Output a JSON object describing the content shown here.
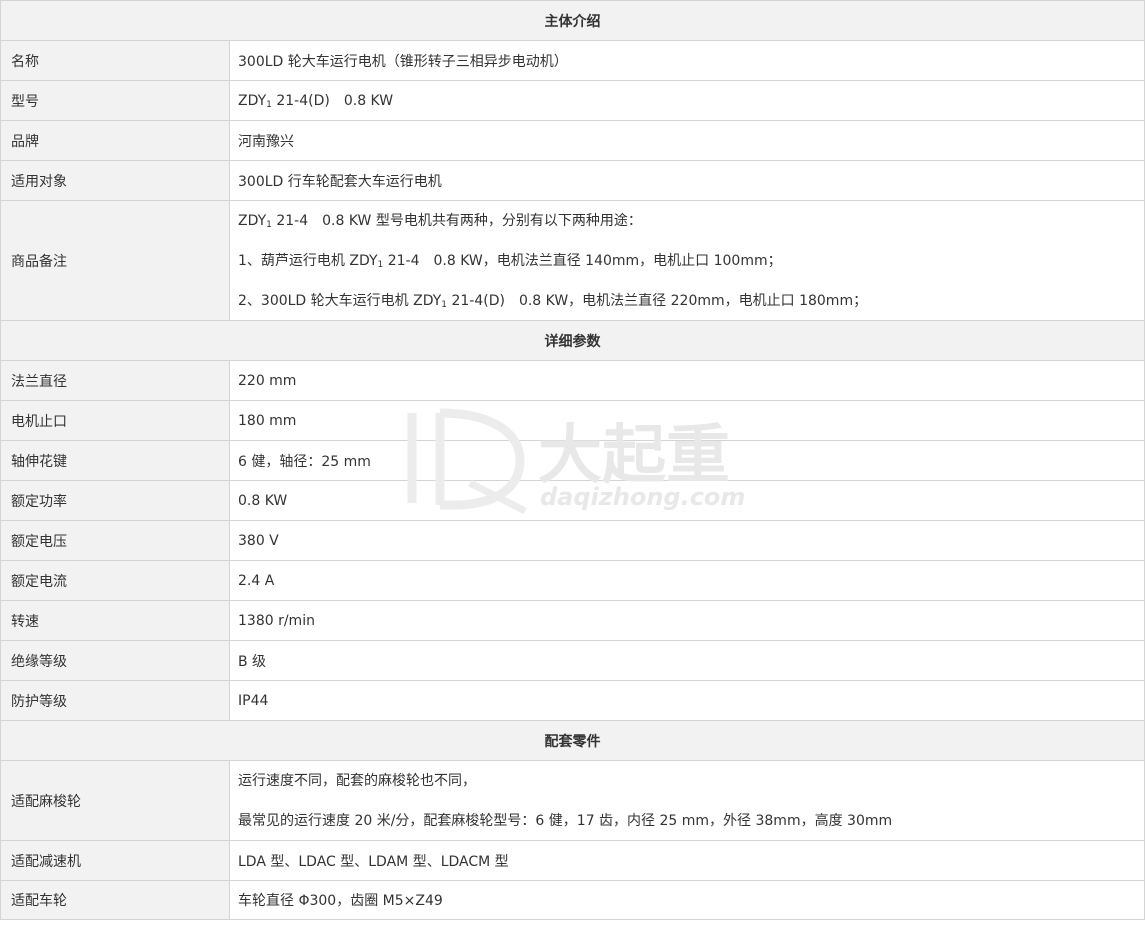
{
  "sections": {
    "intro": "主体介绍",
    "params": "详细参数",
    "parts": "配套零件"
  },
  "intro": {
    "name_label": "名称",
    "name_value": "300LD 轮大车运行电机（锥形转子三相异步电动机）",
    "model_label": "型号",
    "model_prefix": "ZDY",
    "model_sub": "1",
    "model_rest": " 21-4(D)　0.8 KW",
    "brand_label": "品牌",
    "brand_value": "河南豫兴",
    "target_label": "适用对象",
    "target_value": "300LD 行车轮配套大车运行电机",
    "note_label": "商品备注",
    "note_line1_prefix": "ZDY",
    "note_line1_sub": "1",
    "note_line1_rest": " 21-4　0.8 KW 型号电机共有两种，分别有以下两种用途：",
    "note_line2_prefix": "1、葫芦运行电机 ZDY",
    "note_line2_sub": "1",
    "note_line2_rest": " 21-4　0.8 KW，电机法兰直径 140mm，电机止口 100mm；",
    "note_line3_prefix": "2、300LD 轮大车运行电机 ZDY",
    "note_line3_sub": "1",
    "note_line3_rest": " 21-4(D)　0.8 KW，电机法兰直径 220mm，电机止口 180mm；"
  },
  "params": [
    {
      "label": "法兰直径",
      "value": "220 mm"
    },
    {
      "label": "电机止口",
      "value": "180 mm"
    },
    {
      "label": "轴伸花键",
      "value": "6 健，轴径：25 mm"
    },
    {
      "label": "额定功率",
      "value": "0.8 KW"
    },
    {
      "label": "额定电压",
      "value": "380 V"
    },
    {
      "label": "额定电流",
      "value": "2.4 A"
    },
    {
      "label": "转速",
      "value": "1380 r/min"
    },
    {
      "label": "绝缘等级",
      "value": "B 级"
    },
    {
      "label": "防护等级",
      "value": "IP44"
    }
  ],
  "parts": {
    "wheel_label": "适配麻梭轮",
    "wheel_line1": "运行速度不同，配套的麻梭轮也不同，",
    "wheel_line2": "最常见的运行速度 20 米/分，配套麻梭轮型号：6 健，17 齿，内径 25 mm，外径 38mm，高度 30mm",
    "reducer_label": "适配减速机",
    "reducer_value": "LDA 型、LDAC 型、LDAM 型、LDACM 型",
    "carwheel_label": "适配车轮",
    "carwheel_value": "车轮直径 Φ300，齿圈 M5×Z49"
  },
  "watermark": {
    "logo_text": "大起重",
    "url_text": "daqizhong.com",
    "color": "#e6e6e6"
  }
}
